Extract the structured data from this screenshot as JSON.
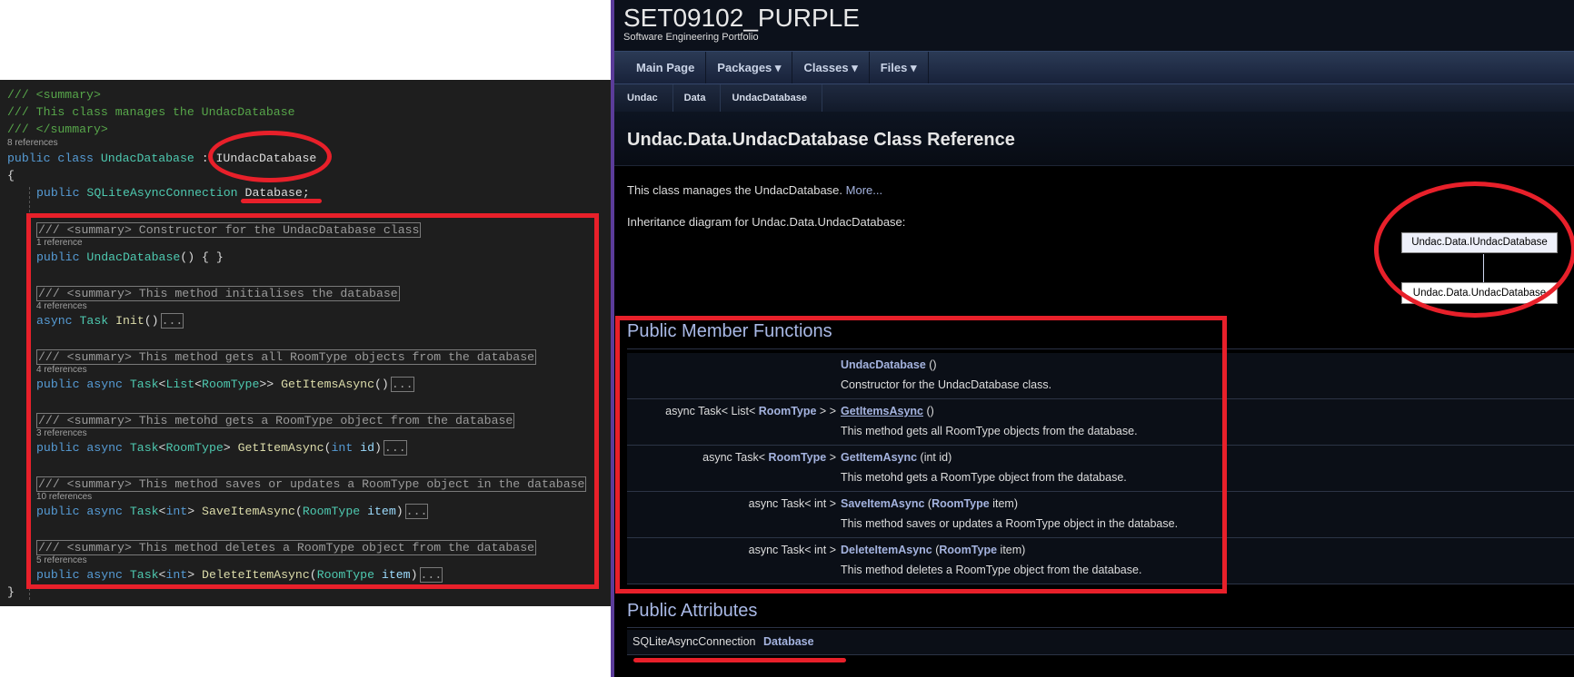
{
  "code": {
    "summary_open": "/// <summary>",
    "summary_text": "/// This class manages the UndacDatabase",
    "summary_close": "/// </summary>",
    "class_refs": "8 references",
    "class_kw": "public class",
    "class_name": "UndacDatabase",
    "class_base": " : IUndacDatabase",
    "open_brace": "{",
    "close_brace": "}",
    "field_kw": "public",
    "field_type": "SQLiteAsyncConnection",
    "field_name": "Database;",
    "ellipsis": "...",
    "members": [
      {
        "comment": "/// <summary> Constructor for the UndacDatabase class",
        "refs": "1 reference",
        "kw": "public",
        "name": "UndacDatabase",
        "tail": "() { }"
      },
      {
        "comment": "/// <summary> This method initialises the database",
        "refs": "4 references",
        "kw": "async",
        "type": "Task",
        "name": "Init",
        "tail": "()"
      },
      {
        "comment": "/// <summary> This method gets all RoomType objects from the database",
        "refs": "4 references",
        "kw": "public async",
        "type": "Task",
        "t1": "List",
        "t2": "RoomType",
        "name": "GetItemsAsync",
        "tail": "()"
      },
      {
        "comment": "/// <summary> This metohd gets a RoomType object from the database",
        "refs": "3 references",
        "kw": "public async",
        "type": "Task",
        "t2": "RoomType",
        "name": "GetItemAsync",
        "p_kw": "int",
        "p_name": "id"
      },
      {
        "comment": "/// <summary> This method saves or updates a RoomType object in the database",
        "refs": "10 references",
        "kw": "public async",
        "type": "Task",
        "tkw": "int",
        "name": "SaveItemAsync",
        "p_type": "RoomType",
        "p_name": "item"
      },
      {
        "comment": "/// <summary> This method deletes a RoomType object from the database",
        "refs": "5 references",
        "kw": "public async",
        "type": "Task",
        "tkw": "int",
        "name": "DeleteItemAsync",
        "p_type": "RoomType",
        "p_name": "item"
      }
    ]
  },
  "doc": {
    "project": "SET09102_PURPLE",
    "brief": "Software Engineering Portfolio",
    "nav": [
      "Main Page",
      "Packages ▾",
      "Classes ▾",
      "Files ▾"
    ],
    "breadcrumb": [
      "Undac",
      "Data",
      "UndacDatabase"
    ],
    "title": "Undac.Data.UndacDatabase Class Reference",
    "description": "This class manages the UndacDatabase.",
    "more": "More...",
    "inheritance_label": "Inheritance diagram for Undac.Data.UndacDatabase:",
    "inheritance": {
      "base": "Undac.Data.IUndacDatabase",
      "derived": "Undac.Data.UndacDatabase"
    },
    "functions_heading": "Public Member Functions",
    "functions": [
      {
        "ret_pre": "",
        "ret_type": "",
        "ret_post": "",
        "name": "UndacDatabase",
        "args": " ()",
        "desc": "Constructor for the UndacDatabase class."
      },
      {
        "ret_pre": "async Task< List< ",
        "ret_type": "RoomType",
        "ret_post": " > >",
        "name": "GetItemsAsync",
        "args": " ()",
        "desc": "This method gets all RoomType objects from the database."
      },
      {
        "ret_pre": "async Task< ",
        "ret_type": "RoomType",
        "ret_post": " >",
        "name": "GetItemAsync",
        "args": " (int id)",
        "desc": "This metohd gets a RoomType object from the database."
      },
      {
        "ret_pre": "async Task< int >",
        "ret_type": "",
        "ret_post": "",
        "name": "SaveItemAsync",
        "args_pre": " (",
        "args_type": "RoomType",
        "args": " item)",
        "desc": "This method saves or updates a RoomType object in the database."
      },
      {
        "ret_pre": "async Task< int >",
        "ret_type": "",
        "ret_post": "",
        "name": "DeleteItemAsync",
        "args_pre": " (",
        "args_type": "RoomType",
        "args": " item)",
        "desc": "This method deletes a RoomType object from the database."
      }
    ],
    "attributes_heading": "Public Attributes",
    "attribute": {
      "type": "SQLiteAsyncConnection",
      "name": "Database"
    }
  }
}
